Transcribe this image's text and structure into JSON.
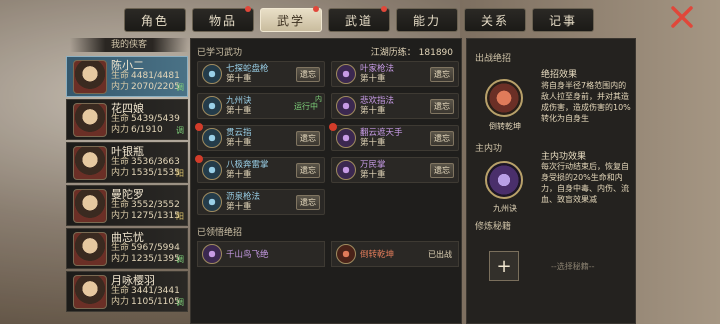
{
  "tabs": [
    {
      "label": "角色",
      "dot": false,
      "active": false
    },
    {
      "label": "物品",
      "dot": true,
      "active": false
    },
    {
      "label": "武学",
      "dot": true,
      "active": true
    },
    {
      "label": "武道",
      "dot": true,
      "active": false
    },
    {
      "label": "能力",
      "dot": false,
      "active": false
    },
    {
      "label": "关系",
      "dot": false,
      "active": false
    },
    {
      "label": "记事",
      "dot": false,
      "active": false
    }
  ],
  "list_header": "我的侠客",
  "characters": [
    {
      "name": "陈小二",
      "hp": "4481/4481",
      "mp": "2070/2205",
      "tag": "调"
    },
    {
      "name": "花四娘",
      "hp": "5439/5439",
      "mp": "6/1910",
      "tag": "调"
    },
    {
      "name": "叶银瓶",
      "hp": "3536/3663",
      "mp": "1535/1535",
      "tag": "阳"
    },
    {
      "name": "曼陀罗",
      "hp": "3552/3552",
      "mp": "1275/1315",
      "tag": "阳"
    },
    {
      "name": "曲忘忧",
      "hp": "5967/5994",
      "mp": "1235/1395",
      "tag": "调"
    },
    {
      "name": "月咏樱羽",
      "hp": "3441/3441",
      "mp": "1105/1105",
      "tag": "调"
    }
  ],
  "labels": {
    "hp": "生命",
    "mp": "内力"
  },
  "learned_title": "已学习武功",
  "experience": "江湖历练：  181890",
  "skills": [
    {
      "name": "七探蛇盘枪",
      "level": "第十重",
      "btn": "遗忘",
      "col": 0,
      "row": 0,
      "color": "blue",
      "warn": false,
      "running": ""
    },
    {
      "name": "叶家枪法",
      "level": "第十重",
      "btn": "遗忘",
      "col": 1,
      "row": 0,
      "color": "purple",
      "warn": false,
      "running": ""
    },
    {
      "name": "九州诀",
      "level": "第十重",
      "btn": "",
      "col": 0,
      "row": 1,
      "color": "blue",
      "warn": false,
      "running": "运行中",
      "nei": "内"
    },
    {
      "name": "悲欢指法",
      "level": "第十重",
      "btn": "遗忘",
      "col": 1,
      "row": 1,
      "color": "purple",
      "warn": false,
      "running": ""
    },
    {
      "name": "贯云指",
      "level": "第十重",
      "btn": "遗忘",
      "col": 0,
      "row": 2,
      "color": "blue",
      "warn": true,
      "running": ""
    },
    {
      "name": "翻云遮天手",
      "level": "第十重",
      "btn": "遗忘",
      "col": 1,
      "row": 2,
      "color": "purple",
      "warn": true,
      "running": ""
    },
    {
      "name": "八极奔雷掌",
      "level": "第十重",
      "btn": "遗忘",
      "col": 0,
      "row": 3,
      "color": "blue",
      "warn": true,
      "running": ""
    },
    {
      "name": "万民掌",
      "level": "第十重",
      "btn": "遗忘",
      "col": 1,
      "row": 3,
      "color": "purple",
      "warn": false,
      "running": ""
    },
    {
      "name": "沥泉枪法",
      "level": "第十重",
      "btn": "遗忘",
      "col": 0,
      "row": 4,
      "color": "blue",
      "warn": false,
      "running": ""
    }
  ],
  "ult_title": "已领悟绝招",
  "ults": [
    {
      "name": "千山鸟飞绝",
      "status": "",
      "color": "purple"
    },
    {
      "name": "倒转乾坤",
      "status": "已出战",
      "color": "red"
    }
  ],
  "right": {
    "ult_section": "出战绝招",
    "ult_name": "倒转乾坤",
    "ult_effect_title": "绝招效果",
    "ult_effect_desc": "将自身半径7格范围内的敌人拉至身前，并对其造成伤害，造成伤害的10%转化为自身生",
    "inner_section": "主内功",
    "inner_name": "九州诀",
    "inner_effect_title": "主内功效果",
    "inner_effect_desc": "每次行动结束后，恢复自身受损的20%生命和内力，自身中毒、内伤、流血、致盲效果减",
    "secret_section": "修炼秘籍",
    "plus": "+",
    "secret_hint": "--选择秘籍--"
  },
  "colors": {
    "accent": "#c9bc9e",
    "selected": "#4a7286"
  }
}
